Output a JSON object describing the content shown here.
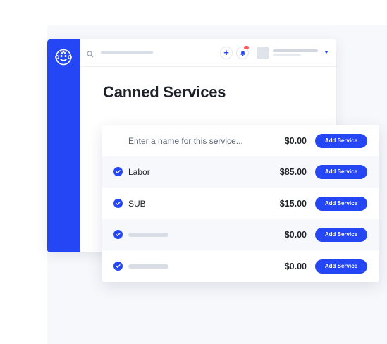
{
  "app": {
    "page_title": "Canned Services",
    "icons": {
      "logo": "monkey-logo-icon",
      "search": "search-icon",
      "add": "plus-icon",
      "notifications": "bell-icon",
      "user_menu": "chevron-down-icon",
      "row_check": "check-circle-icon"
    },
    "colors": {
      "accent": "#2446f5",
      "notification": "#ff5a5f",
      "text": "#1e2129"
    }
  },
  "topbar": {
    "plus_label": "+"
  },
  "services": {
    "new_row": {
      "placeholder": "Enter a name for this service...",
      "price": "$0.00",
      "button_label": "Add Service"
    },
    "rows": [
      {
        "label": "Labor",
        "price": "$85.00",
        "button_label": "Add Service",
        "checked": true
      },
      {
        "label": "SUB",
        "price": "$15.00",
        "button_label": "Add Service",
        "checked": true
      },
      {
        "label": "",
        "price": "$0.00",
        "button_label": "Add Service",
        "checked": true
      },
      {
        "label": "",
        "price": "$0.00",
        "button_label": "Add Service",
        "checked": true
      }
    ]
  }
}
